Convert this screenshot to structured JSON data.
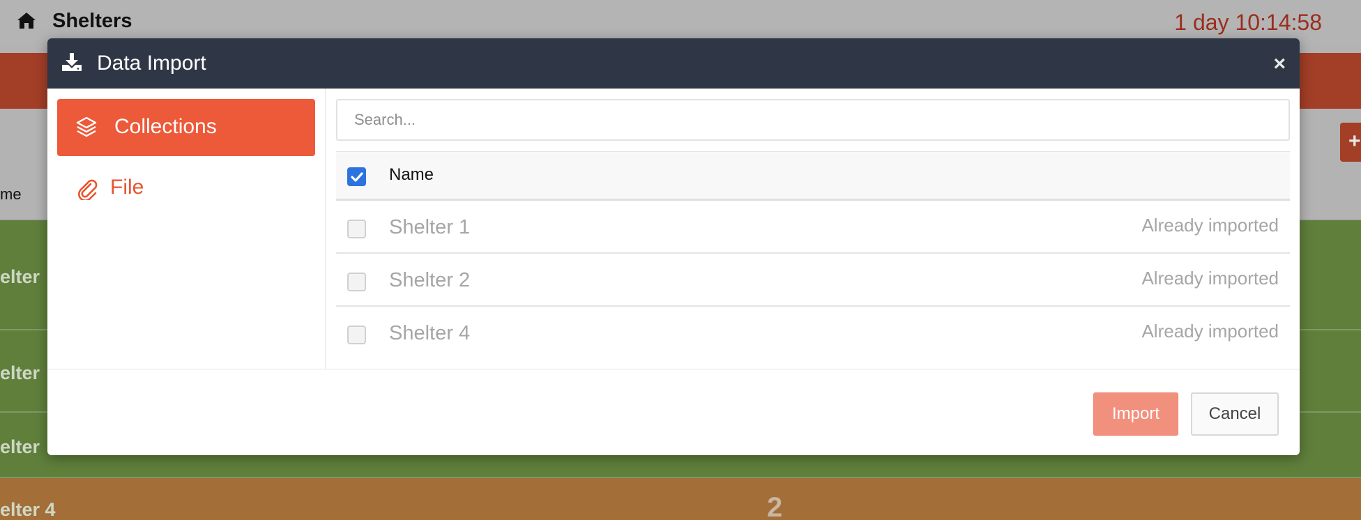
{
  "app": {
    "title": "Shelters",
    "timer": "1 day 10:14:58"
  },
  "background": {
    "column_header": "me",
    "rows": [
      "elter",
      "elter",
      "elter",
      "elter 4"
    ],
    "big_number": "2",
    "add_button": "+"
  },
  "modal": {
    "title": "Data Import",
    "close_label": "×",
    "sidebar": {
      "items": [
        {
          "label": "Collections",
          "icon": "layers-icon",
          "active": true
        },
        {
          "label": "File",
          "icon": "paperclip-icon",
          "active": false
        }
      ]
    },
    "search": {
      "placeholder": "Search...",
      "value": ""
    },
    "table": {
      "header": {
        "name": "Name",
        "select_all_checked": true
      },
      "rows": [
        {
          "name": "Shelter 1",
          "status": "Already imported",
          "checked": false,
          "disabled": true
        },
        {
          "name": "Shelter 2",
          "status": "Already imported",
          "checked": false,
          "disabled": true
        },
        {
          "name": "Shelter 4",
          "status": "Already imported",
          "checked": false,
          "disabled": true
        }
      ]
    },
    "footer": {
      "import_label": "Import",
      "cancel_label": "Cancel"
    }
  },
  "colors": {
    "accent": "#ec5a3a",
    "modal_header": "#2f3646",
    "import_disabled": "#f2907e",
    "checkbox_checked": "#2d73e0"
  }
}
